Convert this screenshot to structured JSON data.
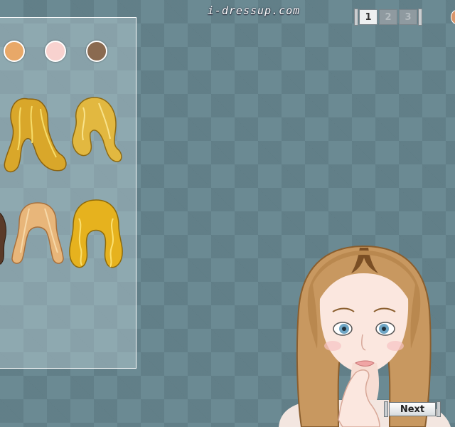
{
  "header": {
    "brand": "i-dressup.com"
  },
  "pager": {
    "pages": [
      "1",
      "2",
      "3"
    ],
    "active": "1"
  },
  "skin_tones": [
    "#e8a868",
    "#f8d2cf",
    "#8a6a50"
  ],
  "hair_options": [
    {
      "name": "long-wavy-golden",
      "color": "#d9a72a"
    },
    {
      "name": "short-curly-golden",
      "color": "#e2b840"
    },
    {
      "name": "dark-brown-partial",
      "color": "#5a3a28"
    },
    {
      "name": "straight-light-strawberry",
      "color": "#e8b67a"
    },
    {
      "name": "long-curly-golden",
      "color": "#e6b21e"
    }
  ],
  "model": {
    "hair_color": "#c89860",
    "eye_color": "#6fa6c5"
  },
  "buttons": {
    "next": "Next"
  }
}
